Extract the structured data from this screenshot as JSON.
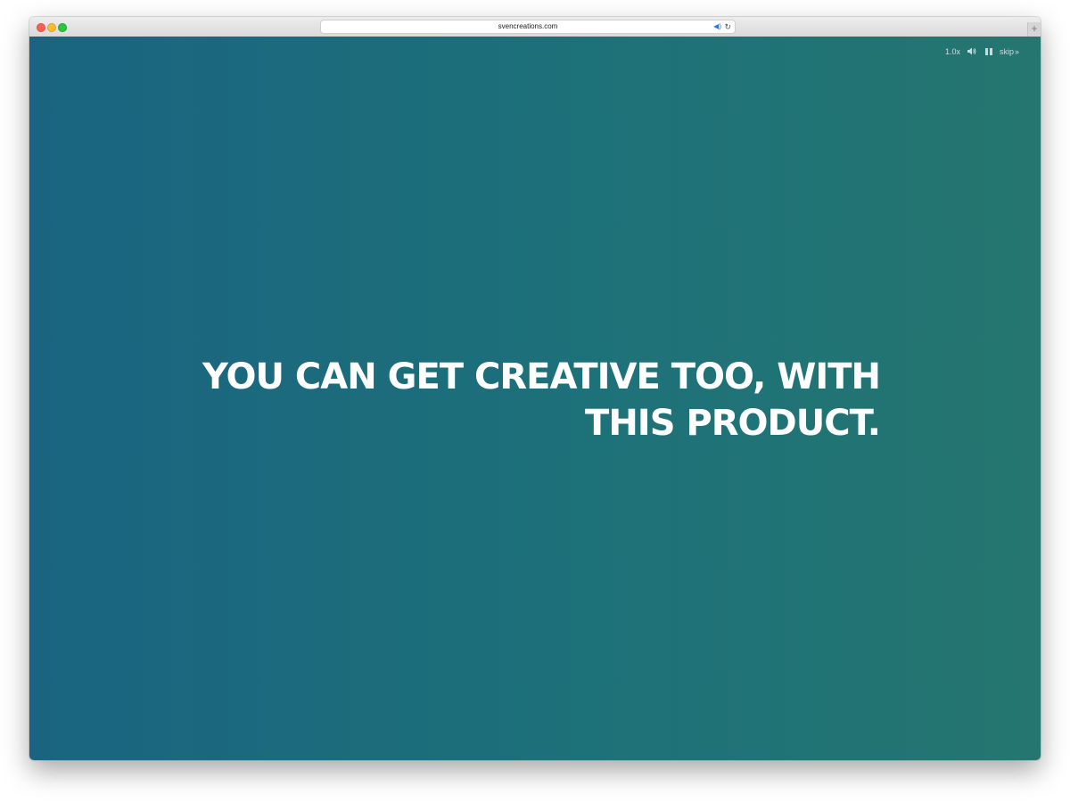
{
  "browser": {
    "url": "svencreations.com",
    "new_tab_symbol": "+",
    "reload_symbol": "↻",
    "audio_symbol": "◀)"
  },
  "player_controls": {
    "speed": "1.0x",
    "volume_icon": "speaker-icon",
    "pause_icon": "pause-icon",
    "skip_label": "skip",
    "skip_arrows": "»"
  },
  "main": {
    "headline": "YOU CAN GET CREATIVE TOO, WITH THIS PRODUCT."
  },
  "colors": {
    "background_left": "#1a6481",
    "background_right": "#257670",
    "text": "#ffffff"
  }
}
